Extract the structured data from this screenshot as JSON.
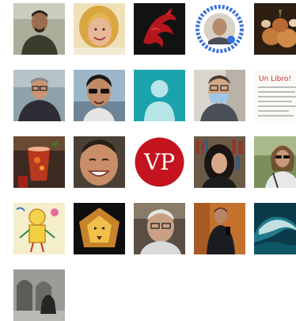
{
  "avatar_grid": {
    "avatars": [
      {
        "kind": "man-dark-shirt-outdoor"
      },
      {
        "kind": "blonde-woman-smiling"
      },
      {
        "kind": "red-dragon-art"
      },
      {
        "kind": "qr-code-portrait"
      },
      {
        "kind": "onions-still-life"
      },
      {
        "kind": "man-glasses-dark-shirt"
      },
      {
        "kind": "man-sunglasses-seaside"
      },
      {
        "kind": "default-placeholder"
      },
      {
        "kind": "man-face-mask"
      },
      {
        "kind": "handwritten-note",
        "text": "Un Libro!"
      },
      {
        "kind": "red-drink-glass"
      },
      {
        "kind": "man-laughing-closeup"
      },
      {
        "kind": "vp-logo",
        "text": "VP"
      },
      {
        "kind": "woman-dark-hair-bookshelf"
      },
      {
        "kind": "woman-sunglasses-outdoor"
      },
      {
        "kind": "child-drawing-yellow-figure"
      },
      {
        "kind": "lion-illustration"
      },
      {
        "kind": "man-white-hair-glasses"
      },
      {
        "kind": "man-mirror-selfie"
      },
      {
        "kind": "ocean-wave"
      },
      {
        "kind": "woman-cloister-black-white"
      }
    ]
  }
}
